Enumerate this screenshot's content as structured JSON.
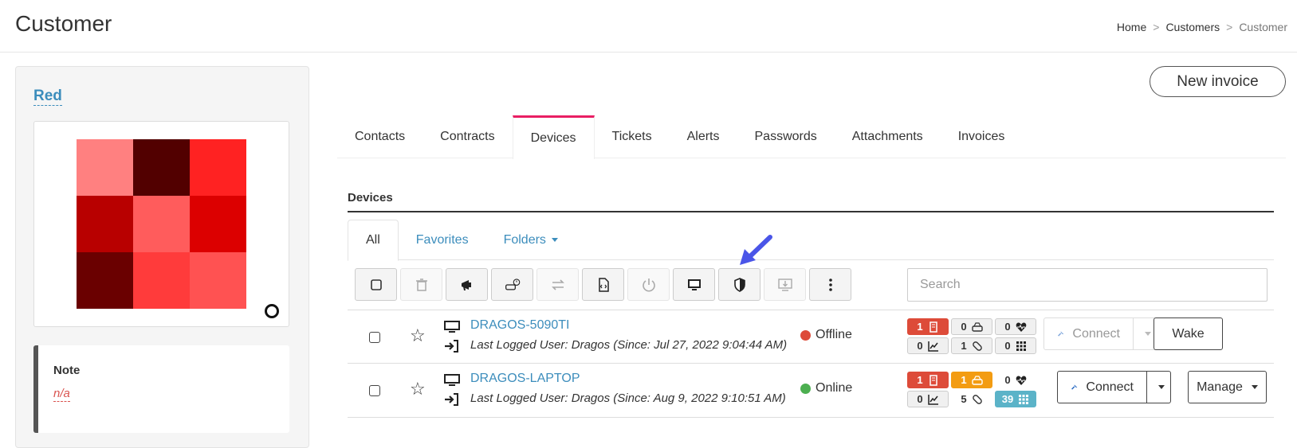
{
  "header": {
    "title": "Customer",
    "breadcrumb": [
      "Home",
      "Customers",
      "Customer"
    ]
  },
  "customer": {
    "name": "Red",
    "identicon_colors": [
      "#ff8080",
      "#520000",
      "#ff2222",
      "#b80000",
      "#ff5c5c",
      "#dc0000",
      "#6a0000",
      "#ff3b3b",
      "#ff5252"
    ],
    "note_label": "Note",
    "note_value": "n/a"
  },
  "actions": {
    "new_invoice": "New invoice"
  },
  "tabs": [
    {
      "label": "Contacts"
    },
    {
      "label": "Contracts"
    },
    {
      "label": "Devices",
      "active": true
    },
    {
      "label": "Tickets"
    },
    {
      "label": "Alerts"
    },
    {
      "label": "Passwords"
    },
    {
      "label": "Attachments"
    },
    {
      "label": "Invoices"
    }
  ],
  "devices": {
    "title": "Devices",
    "subtabs": {
      "all": "All",
      "favorites": "Favorites",
      "folders": "Folders"
    },
    "search": {
      "placeholder": "Search",
      "value": ""
    },
    "toolbar_icons": [
      "select-all-checkbox",
      "delete-icon",
      "announce-icon",
      "disk-clock-icon",
      "transfer-icon",
      "script-icon",
      "power-icon",
      "remote-screen-icon",
      "shield-icon",
      "download-screen-icon",
      "more-icon"
    ],
    "rows": [
      {
        "name": "DRAGOS-5090TI",
        "user": "Last Logged User: Dragos (Since: Jul 27, 2022 9:04:44 AM)",
        "status": "Offline",
        "status_color": "#dd4b39",
        "badges": {
          "alerts": "1",
          "disks": "0",
          "health": "0",
          "perf": "0",
          "patches": "1",
          "apps": "0"
        },
        "connect": "Connect",
        "action": "Wake"
      },
      {
        "name": "DRAGOS-LAPTOP",
        "user": "Last Logged User: Dragos (Since: Aug 9, 2022 9:10:51 AM)",
        "status": "Online",
        "status_color": "#4caf50",
        "badges": {
          "alerts": "1",
          "disks": "1",
          "health": "0",
          "perf": "0",
          "patches": "5",
          "apps": "39"
        },
        "connect": "Connect",
        "action": "Manage"
      }
    ]
  },
  "colors": {
    "accent": "#3c8dbc",
    "tab_active": "#e91e63",
    "annotation_arrow": "#4a55e8"
  }
}
